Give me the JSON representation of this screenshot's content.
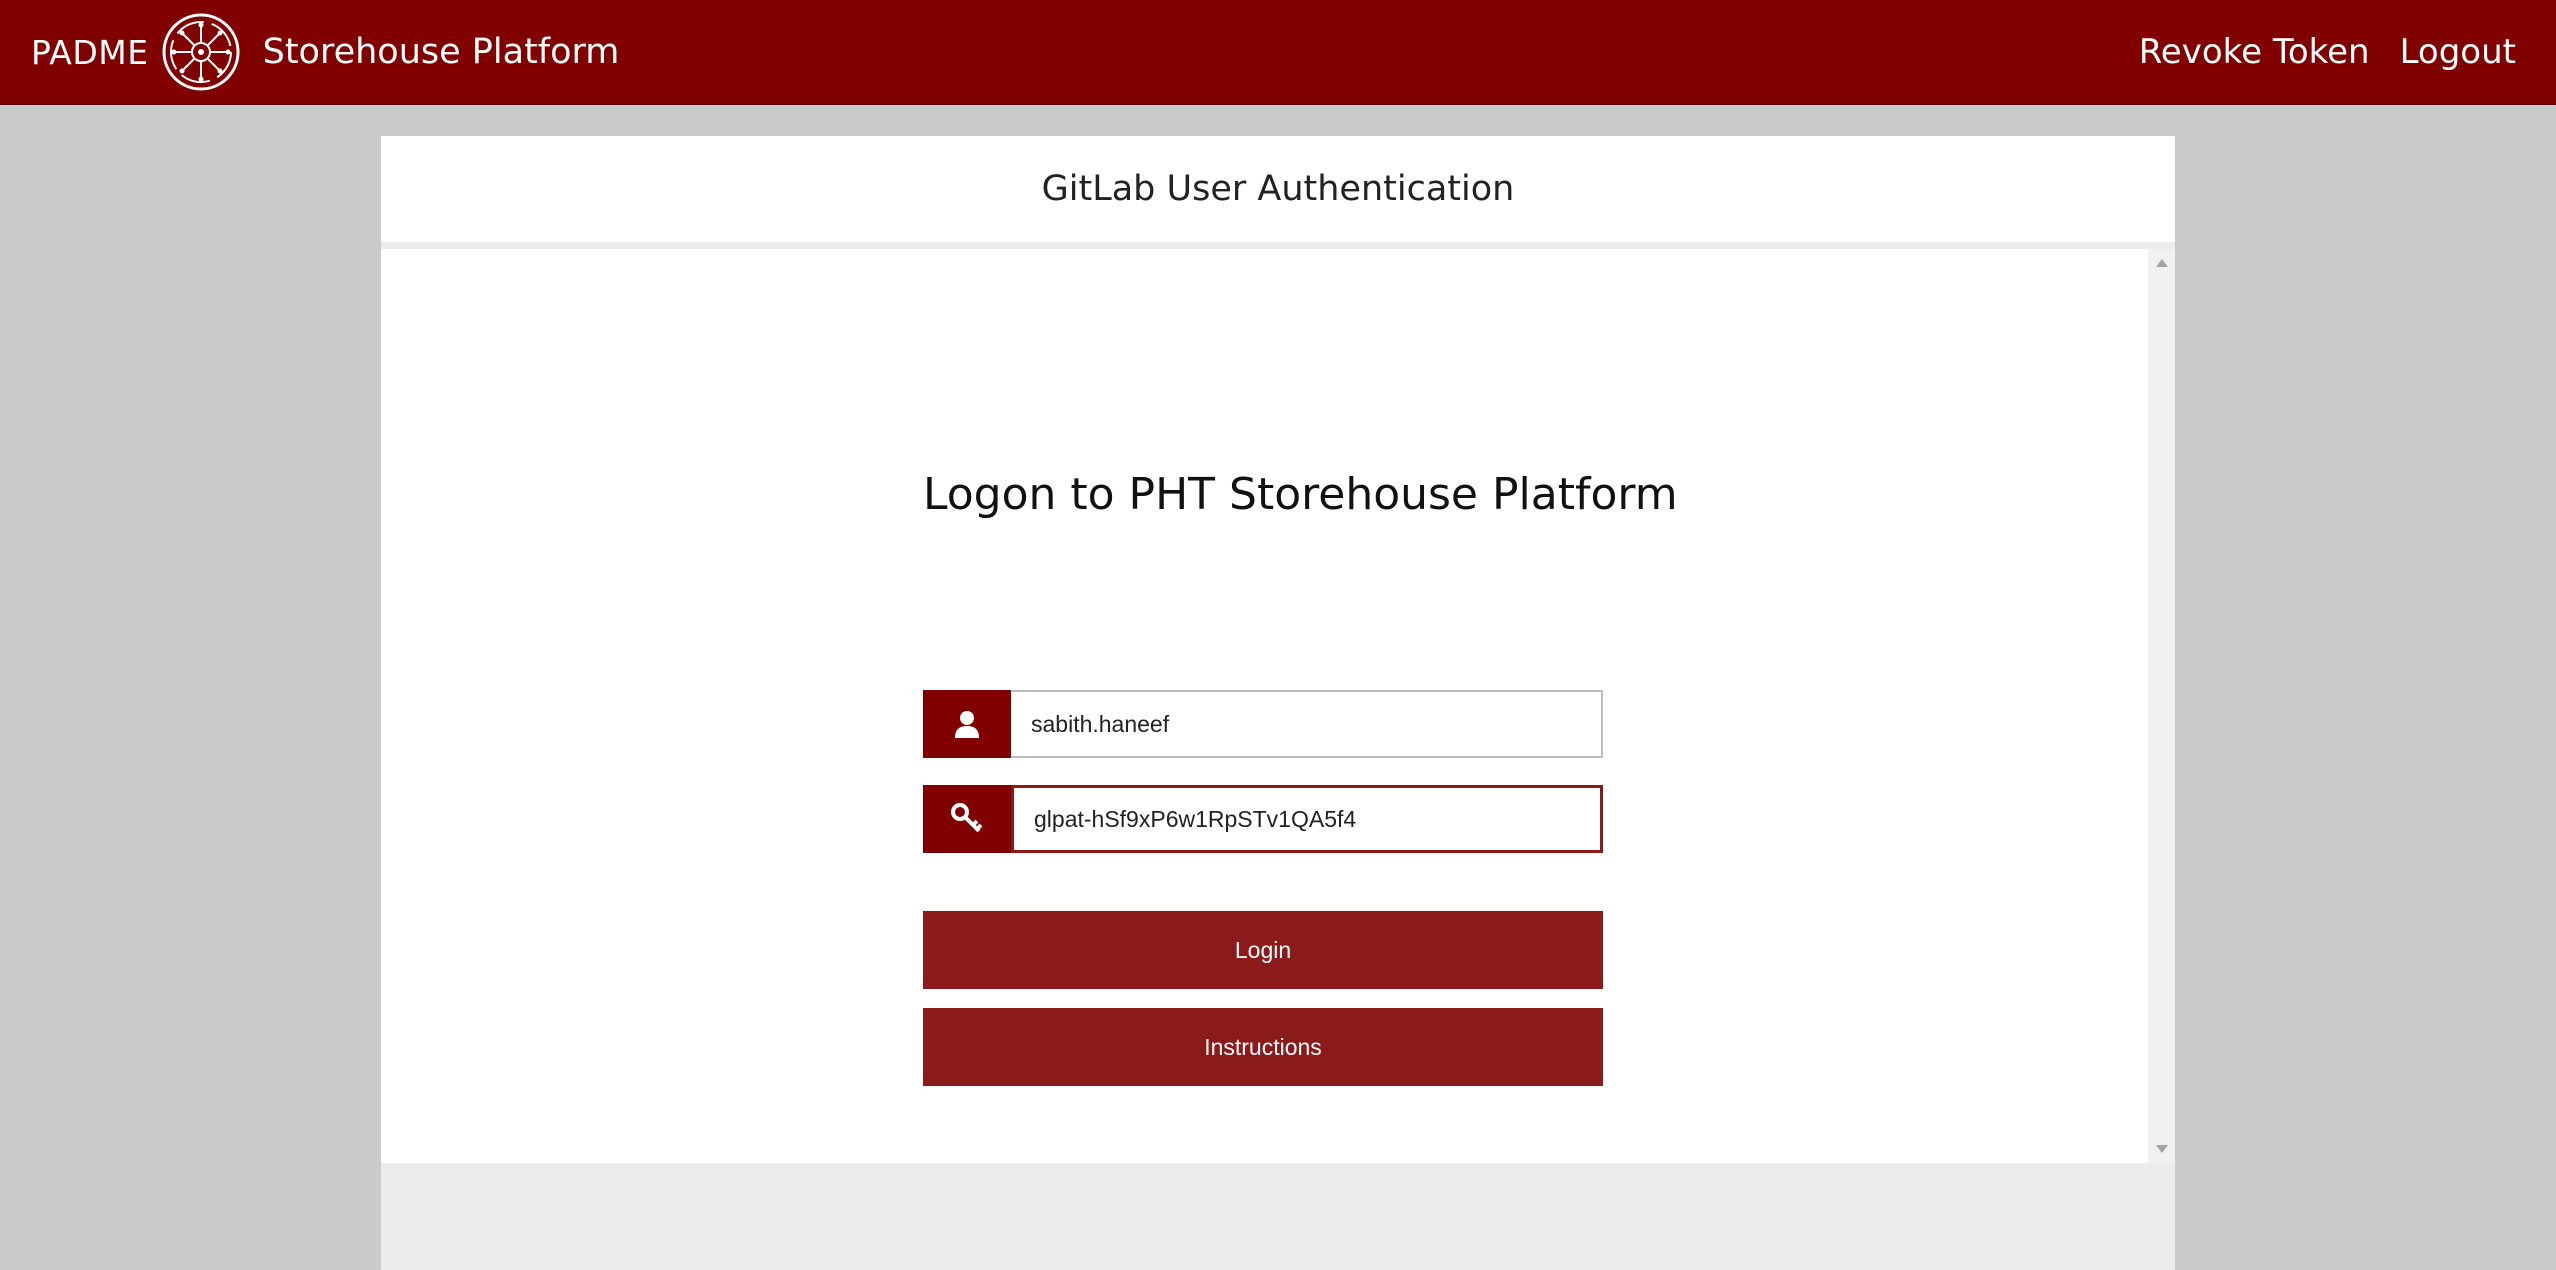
{
  "navbar": {
    "brand": "PADME",
    "title": "Storehouse Platform",
    "links": {
      "revoke": "Revoke Token",
      "logout": "Logout"
    },
    "logo_icon": "padme-logo",
    "background": "#800000"
  },
  "panel": {
    "title": "GitLab User Authentication"
  },
  "login": {
    "heading": "Logon to PHT Storehouse Platform",
    "username": {
      "icon": "user-icon",
      "value": "sabith.haneef"
    },
    "token": {
      "icon": "key-icon",
      "value": "glpat-hSf9xP6w1RpSTv1QA5f4"
    },
    "login_button": "Login",
    "instructions_button": "Instructions",
    "accent": "#8b1a1a"
  }
}
